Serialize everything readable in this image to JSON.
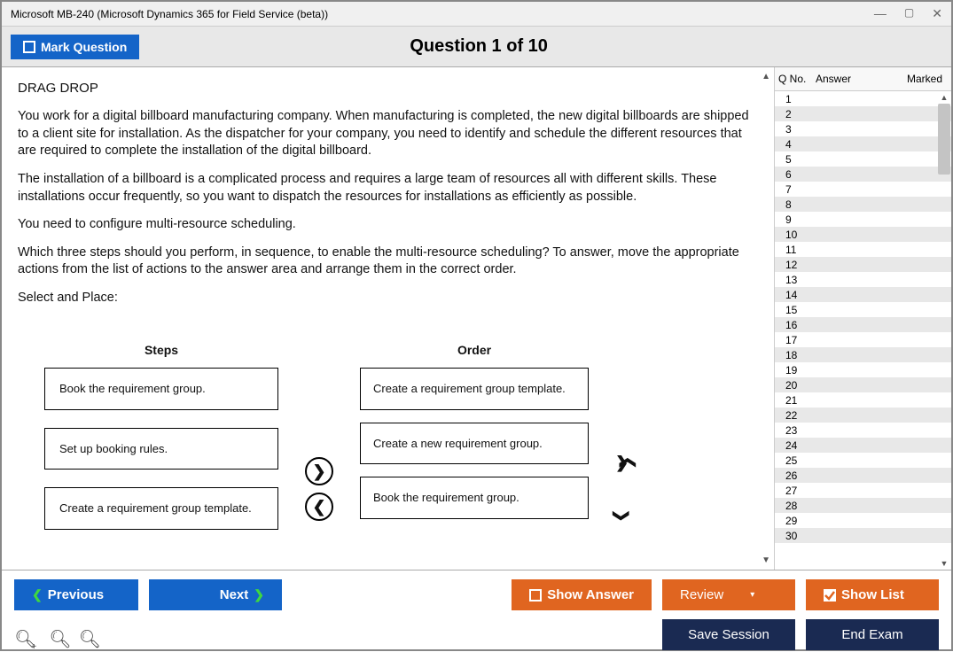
{
  "window": {
    "title": "Microsoft MB-240 (Microsoft Dynamics 365 for Field Service (beta))"
  },
  "topbar": {
    "mark_label": "Mark Question",
    "question_title": "Question 1 of 10"
  },
  "question": {
    "heading": "DRAG DROP",
    "p1": "You work for a digital billboard manufacturing company. When manufacturing is completed, the new digital billboards are shipped to a client site for installation. As the dispatcher for your company, you need to identify and schedule the different resources that are required to complete the installation of the digital billboard.",
    "p2": "The installation of a billboard is a complicated process and requires a large team of resources all with different skills. These installations occur frequently, so you want to dispatch the resources for installations as efficiently as possible.",
    "p3": "You need to configure multi-resource scheduling.",
    "p4": "Which three steps should you perform, in sequence, to enable the multi-resource scheduling? To answer, move the appropriate actions from the list of actions to the answer area and arrange them in the correct order.",
    "p5": "Select and Place:"
  },
  "dragdrop": {
    "steps_header": "Steps",
    "order_header": "Order",
    "steps": [
      "Book the requirement group.",
      "Set up booking rules.",
      "Create a requirement group template."
    ],
    "order": [
      "Create a requirement group template.",
      "Create a new requirement group.",
      "Book the requirement group."
    ]
  },
  "sidebar": {
    "headers": {
      "qno": "Q No.",
      "answer": "Answer",
      "marked": "Marked"
    },
    "rows": [
      1,
      2,
      3,
      4,
      5,
      6,
      7,
      8,
      9,
      10,
      11,
      12,
      13,
      14,
      15,
      16,
      17,
      18,
      19,
      20,
      21,
      22,
      23,
      24,
      25,
      26,
      27,
      28,
      29,
      30
    ]
  },
  "buttons": {
    "previous": "Previous",
    "next": "Next",
    "show_answer": "Show Answer",
    "review": "Review",
    "show_list": "Show List",
    "save_session": "Save Session",
    "end_exam": "End Exam"
  }
}
